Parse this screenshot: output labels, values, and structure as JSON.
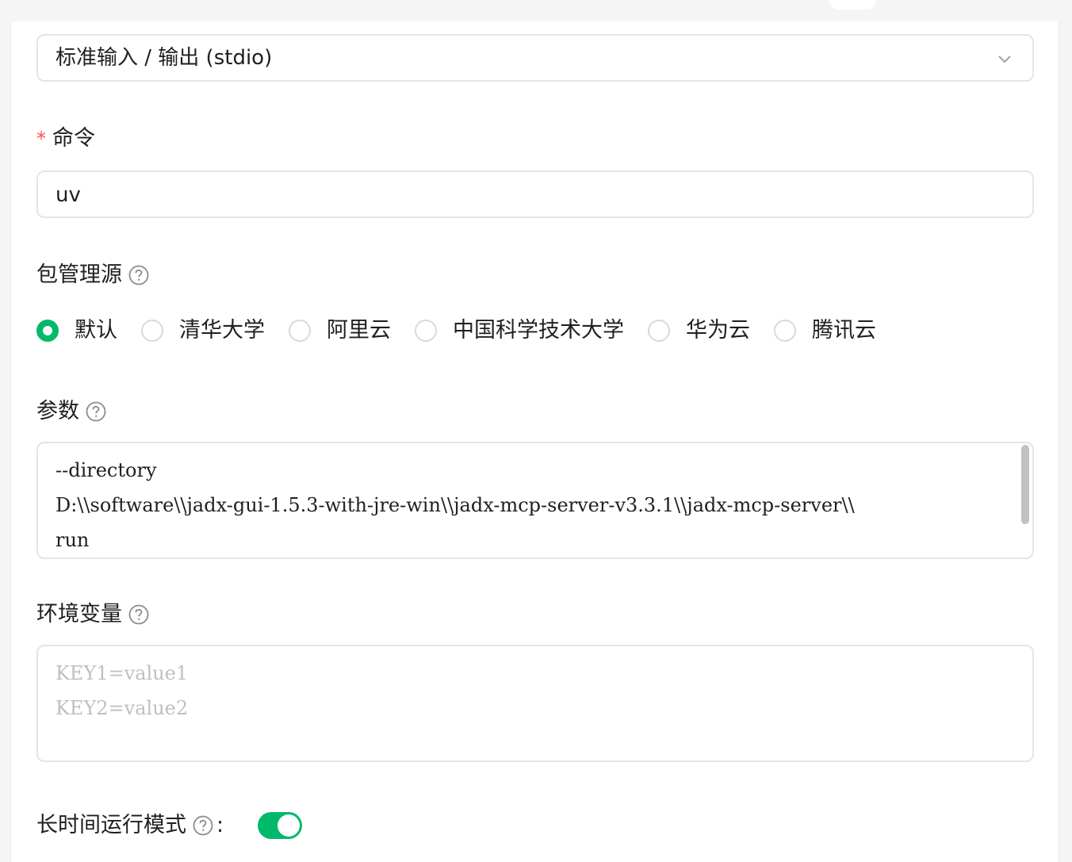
{
  "transport": {
    "selected": "标准输入 / 输出 (stdio)"
  },
  "command": {
    "required_mark": "*",
    "label": "命令",
    "value": "uv"
  },
  "registry": {
    "label": "包管理源",
    "options": [
      {
        "label": "默认",
        "checked": true
      },
      {
        "label": "清华大学",
        "checked": false
      },
      {
        "label": "阿里云",
        "checked": false
      },
      {
        "label": "中国科学技术大学",
        "checked": false
      },
      {
        "label": "华为云",
        "checked": false
      },
      {
        "label": "腾讯云",
        "checked": false
      }
    ]
  },
  "args": {
    "label": "参数",
    "value": "--directory\nD:\\\\software\\\\jadx-gui-1.5.3-with-jre-win\\\\jadx-mcp-server-v3.3.1\\\\jadx-mcp-server\\\\\nrun"
  },
  "env": {
    "label": "环境变量",
    "placeholder": "KEY1=value1\nKEY2=value2"
  },
  "long_running": {
    "label": "长时间运行模式",
    "suffix": ":",
    "enabled": true
  },
  "colors": {
    "accent": "#00b96b",
    "required": "#ff4d4f",
    "border": "#e5e5e5"
  }
}
